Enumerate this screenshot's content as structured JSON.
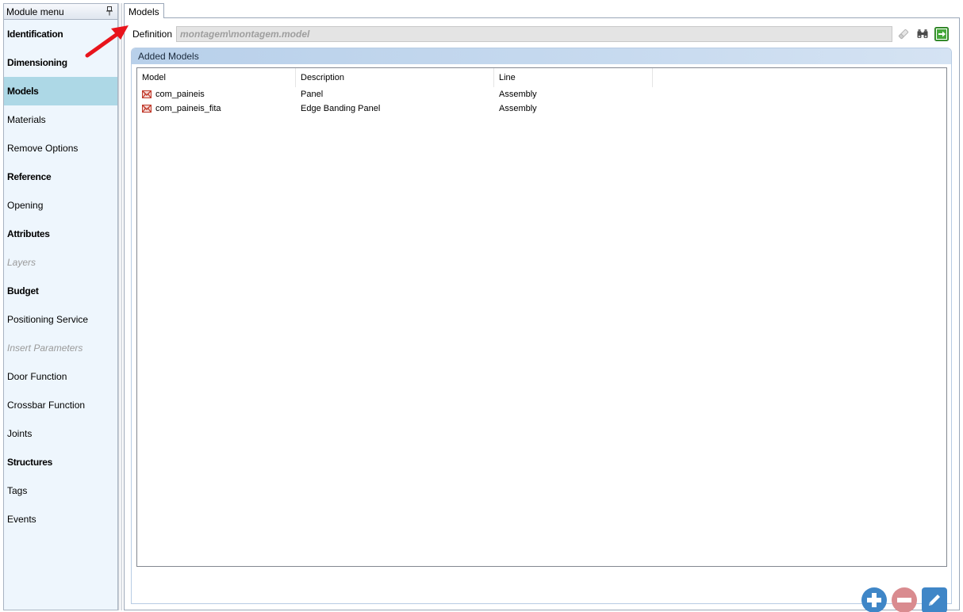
{
  "sidebar": {
    "title": "Module menu",
    "items": [
      {
        "label": "Identification",
        "style": "bold"
      },
      {
        "label": "Dimensioning",
        "style": "bold"
      },
      {
        "label": "Models",
        "style": "bold",
        "selected": true
      },
      {
        "label": "Materials",
        "style": "normal"
      },
      {
        "label": "Remove Options",
        "style": "normal"
      },
      {
        "label": "Reference",
        "style": "bold"
      },
      {
        "label": "Opening",
        "style": "normal"
      },
      {
        "label": "Attributes",
        "style": "bold"
      },
      {
        "label": "Layers",
        "style": "disabled"
      },
      {
        "label": "Budget",
        "style": "bold"
      },
      {
        "label": "Positioning Service",
        "style": "normal"
      },
      {
        "label": "Insert Parameters",
        "style": "disabled"
      },
      {
        "label": "Door Function",
        "style": "normal"
      },
      {
        "label": "Crossbar Function",
        "style": "normal"
      },
      {
        "label": "Joints",
        "style": "normal"
      },
      {
        "label": "Structures",
        "style": "bold"
      },
      {
        "label": "Tags",
        "style": "normal"
      },
      {
        "label": "Events",
        "style": "normal"
      }
    ]
  },
  "tab": {
    "label": "Models"
  },
  "definition": {
    "label": "Definition",
    "value": "montagem\\montagem.model"
  },
  "added_models": {
    "title": "Added Models",
    "columns": [
      "Model",
      "Description",
      "Line"
    ],
    "rows": [
      {
        "model": "com_paineis",
        "description": "Panel",
        "line": "Assembly"
      },
      {
        "model": "com_paineis_fita",
        "description": "Edge Banding Panel",
        "line": "Assembly"
      }
    ]
  },
  "colors": {
    "selected_item": "#add8e6",
    "add_button": "#3f86c7",
    "remove_button": "#d98b8f",
    "annotation_arrow": "#e8141c"
  }
}
